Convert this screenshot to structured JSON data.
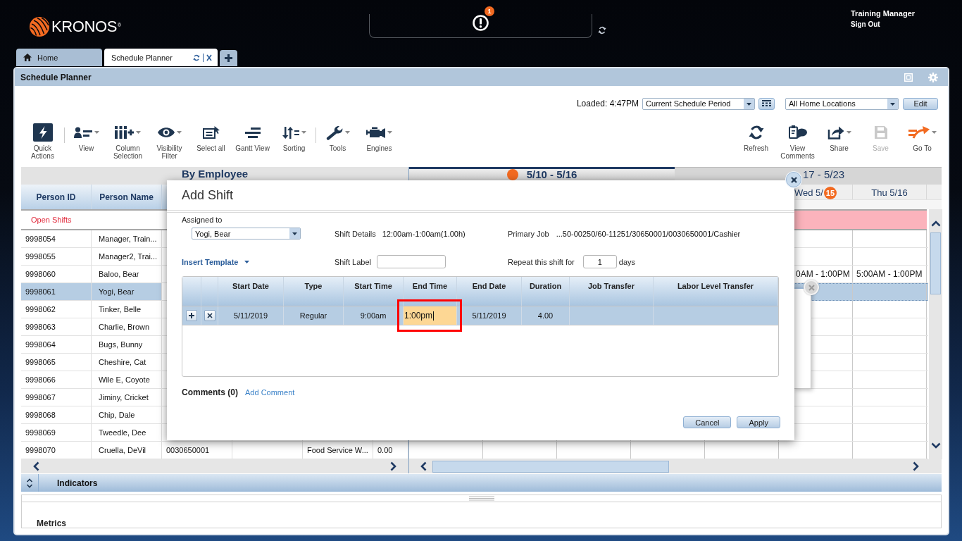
{
  "header": {
    "logo": {
      "wordmark": "KRONOS",
      "mark": "®"
    },
    "notifications": {
      "badge": "1"
    },
    "user": {
      "name": "Training Manager",
      "sign_out": "Sign Out"
    }
  },
  "tabs": [
    {
      "label": "Home",
      "kind": "home",
      "selected": false
    },
    {
      "label": "Schedule Planner",
      "kind": "workspace",
      "selected": true
    }
  ],
  "panel": {
    "title": "Schedule Planner"
  },
  "toolbar": {
    "loaded": "Loaded: 4:47PM",
    "period": "Current Schedule Period",
    "location": "All Home Locations",
    "edit": "Edit",
    "groups": [
      [
        {
          "label": "Quick Actions",
          "has_menu": false,
          "disabled": false
        }
      ],
      [
        {
          "label": "View",
          "has_menu": true,
          "disabled": false
        },
        {
          "label": "Column Selection",
          "has_menu": true,
          "disabled": false
        },
        {
          "label": "Visibility Filter",
          "has_menu": true,
          "disabled": false
        },
        {
          "label": "Select all",
          "has_menu": false,
          "disabled": false
        },
        {
          "label": "Gantt View",
          "has_menu": false,
          "disabled": false
        },
        {
          "label": "Sorting",
          "has_menu": true,
          "disabled": false
        }
      ],
      [
        {
          "label": "Tools",
          "has_menu": true,
          "disabled": false
        },
        {
          "label": "Engines",
          "has_menu": true,
          "disabled": false
        }
      ]
    ],
    "right": [
      {
        "label": "Refresh",
        "has_menu": false,
        "disabled": false
      },
      {
        "label": "View Comments",
        "has_menu": false,
        "disabled": false
      },
      {
        "label": "Share",
        "has_menu": true,
        "disabled": false
      },
      {
        "label": "Save",
        "has_menu": false,
        "disabled": true
      },
      {
        "label": "Go To",
        "has_menu": true,
        "disabled": false
      }
    ]
  },
  "employee_table": {
    "title": "By Employee",
    "columns": [
      "Person ID",
      "Person Name"
    ],
    "open_shifts": "Open Shifts",
    "rows": [
      {
        "id": "9998054",
        "name": "Manager, Train...",
        "selected": false
      },
      {
        "id": "9998055",
        "name": "Manager2, Trai...",
        "selected": false
      },
      {
        "id": "9998060",
        "name": "Baloo, Bear",
        "selected": false,
        "shifts": [
          "0AM - 1:00PM",
          "5:00AM - 1:00PM"
        ]
      },
      {
        "id": "9998061",
        "name": "Yogi, Bear",
        "selected": true
      },
      {
        "id": "9998062",
        "name": "Tinker, Belle",
        "selected": false
      },
      {
        "id": "9998063",
        "name": "Charlie, Brown",
        "selected": false
      },
      {
        "id": "9998064",
        "name": "Bugs, Bunny",
        "selected": false
      },
      {
        "id": "9998065",
        "name": "Cheshire, Cat",
        "selected": false
      },
      {
        "id": "9998066",
        "name": "Wile E, Coyote",
        "selected": false
      },
      {
        "id": "9998067",
        "name": "Jiminy, Cricket",
        "selected": false
      },
      {
        "id": "9998068",
        "name": "Chip, Dale",
        "selected": false
      },
      {
        "id": "9998069",
        "name": "Tweedle, Dee",
        "selected": false
      },
      {
        "id": "9998070",
        "name": "Cruella, DeVil",
        "selected": false,
        "column_3": "0030650001",
        "column_5": "Food Service W...",
        "column_6": "0.00"
      }
    ]
  },
  "calendar": {
    "weeks": [
      {
        "label": "5/10 - 5/16",
        "selected": true
      },
      {
        "label": "17 - 5/23",
        "selected": false
      }
    ],
    "days": [
      {
        "label": "Wed 5/",
        "badge": "15"
      },
      {
        "label": "Thu 5/16"
      }
    ]
  },
  "add_shift_dialog": {
    "title": "Add Shift",
    "assigned_to": {
      "label": "Assigned to",
      "value": "Yogi, Bear"
    },
    "shift_details": {
      "label": "Shift Details",
      "value": "12:00am-1:00am(1.00h)"
    },
    "primary_job": {
      "label": "Primary Job",
      "value": "...50-00250/60-11251/30650001/0030650001/Cashier"
    },
    "insert_template": "Insert Template",
    "shift_label": {
      "label": "Shift Label"
    },
    "repeat": {
      "label": "Repeat this shift for",
      "value": "1",
      "unit": "days"
    },
    "grid": {
      "columns": [
        "Start Date",
        "Type",
        "Start Time",
        "End Time",
        "End Date",
        "Duration",
        "Job Transfer",
        "Labor Level Transfer"
      ],
      "rows": [
        {
          "start_date": "5/11/2019",
          "type": "Regular",
          "start_time": "9:00am",
          "end_time": {
            "value": "1:00pm",
            "focused": true,
            "highlighted": true
          },
          "end_date": "5/11/2019",
          "duration": "4.00",
          "selected": true
        }
      ]
    },
    "comments": {
      "label": "Comments (0)",
      "link": "Add Comment"
    },
    "buttons": [
      {
        "label": "Cancel"
      },
      {
        "label": "Apply"
      }
    ]
  },
  "bottom": {
    "indicators": "Indicators",
    "metrics": "Metrics"
  }
}
